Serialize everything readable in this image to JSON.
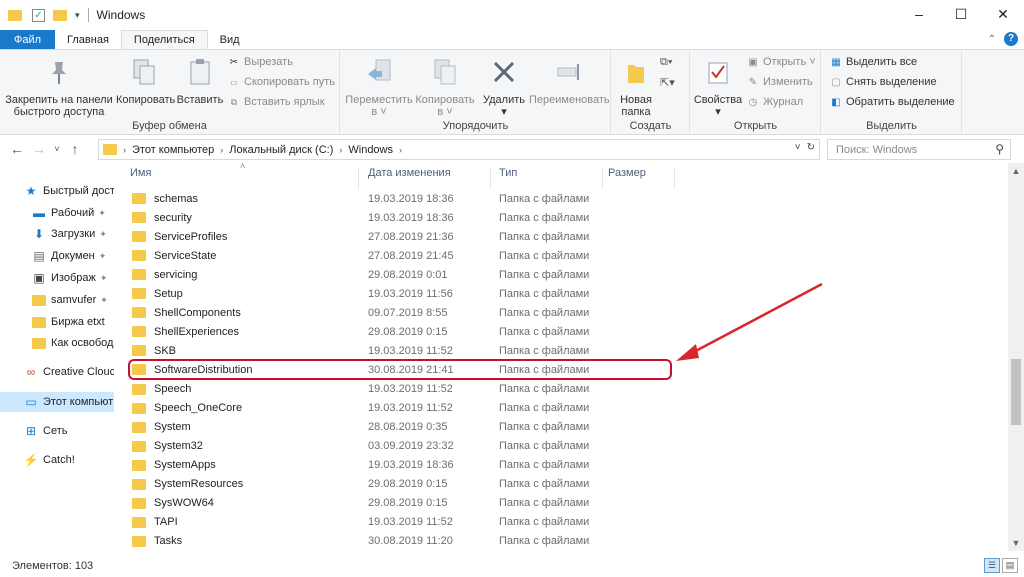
{
  "window": {
    "title": "Windows",
    "minimize": "–",
    "maximize": "☐",
    "close": "✕"
  },
  "tabs": [
    {
      "label": "Файл"
    },
    {
      "label": "Главная"
    },
    {
      "label": "Поделиться"
    },
    {
      "label": "Вид"
    }
  ],
  "ribbon": {
    "clipboard": {
      "label": "Буфер обмена",
      "pin": "Закрепить на панели\nбыстрого доступа",
      "copy": "Копировать",
      "paste": "Вставить",
      "cut": "Вырезать",
      "copy_path": "Скопировать путь",
      "paste_shortcut": "Вставить ярлык"
    },
    "organize": {
      "label": "Упорядочить",
      "move": "Переместить\nв ˅",
      "copy_to": "Копировать\nв ˅",
      "delete": "Удалить\n▾",
      "rename": "Переименовать"
    },
    "new": {
      "label": "Создать",
      "new_folder": "Новая\nпапка"
    },
    "open": {
      "label": "Открыть",
      "properties": "Свойства\n▾",
      "open": "Открыть ˅",
      "edit": "Изменить",
      "history": "Журнал"
    },
    "select": {
      "label": "Выделить",
      "select_all": "Выделить все",
      "select_none": "Снять выделение",
      "invert": "Обратить выделение"
    }
  },
  "address": {
    "crumbs": [
      "Этот компьютер",
      "Локальный диск (C:)",
      "Windows"
    ],
    "search_placeholder": "Поиск: Windows"
  },
  "nav": [
    {
      "label": "Быстрый дост",
      "icon": "star-icon",
      "pinned": false
    },
    {
      "label": "Рабочий",
      "icon": "desktop-icon",
      "pinned": true
    },
    {
      "label": "Загрузки",
      "icon": "download-icon",
      "pinned": true
    },
    {
      "label": "Докумен",
      "icon": "document-icon",
      "pinned": true
    },
    {
      "label": "Изображ",
      "icon": "image-icon",
      "pinned": true
    },
    {
      "label": "samvufer",
      "icon": "folder-icon",
      "pinned": true
    },
    {
      "label": "Биржа etxt",
      "icon": "folder-icon",
      "pinned": false
    },
    {
      "label": "Как освобод",
      "icon": "folder-icon",
      "pinned": false
    },
    {
      "label": "Creative Clouc",
      "icon": "creative-cloud-icon",
      "pinned": false
    },
    {
      "label": "Этот компьют",
      "icon": "computer-icon",
      "pinned": false
    },
    {
      "label": "Сеть",
      "icon": "network-icon",
      "pinned": false
    },
    {
      "label": "Catch!",
      "icon": "catch-icon",
      "pinned": false
    }
  ],
  "columns": {
    "name": "Имя",
    "date": "Дата изменения",
    "type": "Тип",
    "size": "Размер"
  },
  "files": [
    {
      "name": "schemas",
      "date": "19.03.2019 18:36",
      "type": "Папка с файлами"
    },
    {
      "name": "security",
      "date": "19.03.2019 18:36",
      "type": "Папка с файлами"
    },
    {
      "name": "ServiceProfiles",
      "date": "27.08.2019 21:36",
      "type": "Папка с файлами"
    },
    {
      "name": "ServiceState",
      "date": "27.08.2019 21:45",
      "type": "Папка с файлами"
    },
    {
      "name": "servicing",
      "date": "29.08.2019 0:01",
      "type": "Папка с файлами"
    },
    {
      "name": "Setup",
      "date": "19.03.2019 11:56",
      "type": "Папка с файлами"
    },
    {
      "name": "ShellComponents",
      "date": "09.07.2019 8:55",
      "type": "Папка с файлами"
    },
    {
      "name": "ShellExperiences",
      "date": "29.08.2019 0:15",
      "type": "Папка с файлами"
    },
    {
      "name": "SKB",
      "date": "19.03.2019 11:52",
      "type": "Папка с файлами"
    },
    {
      "name": "SoftwareDistribution",
      "date": "30.08.2019 21:41",
      "type": "Папка с файлами"
    },
    {
      "name": "Speech",
      "date": "19.03.2019 11:52",
      "type": "Папка с файлами"
    },
    {
      "name": "Speech_OneCore",
      "date": "19.03.2019 11:52",
      "type": "Папка с файлами"
    },
    {
      "name": "System",
      "date": "28.08.2019 0:35",
      "type": "Папка с файлами"
    },
    {
      "name": "System32",
      "date": "03.09.2019 23:32",
      "type": "Папка с файлами"
    },
    {
      "name": "SystemApps",
      "date": "19.03.2019 18:36",
      "type": "Папка с файлами"
    },
    {
      "name": "SystemResources",
      "date": "29.08.2019 0:15",
      "type": "Папка с файлами"
    },
    {
      "name": "SysWOW64",
      "date": "29.08.2019 0:15",
      "type": "Папка с файлами"
    },
    {
      "name": "TAPI",
      "date": "19.03.2019 11:52",
      "type": "Папка с файлами"
    },
    {
      "name": "Tasks",
      "date": "30.08.2019 11:20",
      "type": "Папка с файлами"
    }
  ],
  "highlighted_file": "SoftwareDistribution",
  "colors": {
    "accent": "#1979ca",
    "highlight": "#c8102e",
    "folder": "#f5c94c"
  },
  "status": {
    "items": "Элементов: 103"
  }
}
